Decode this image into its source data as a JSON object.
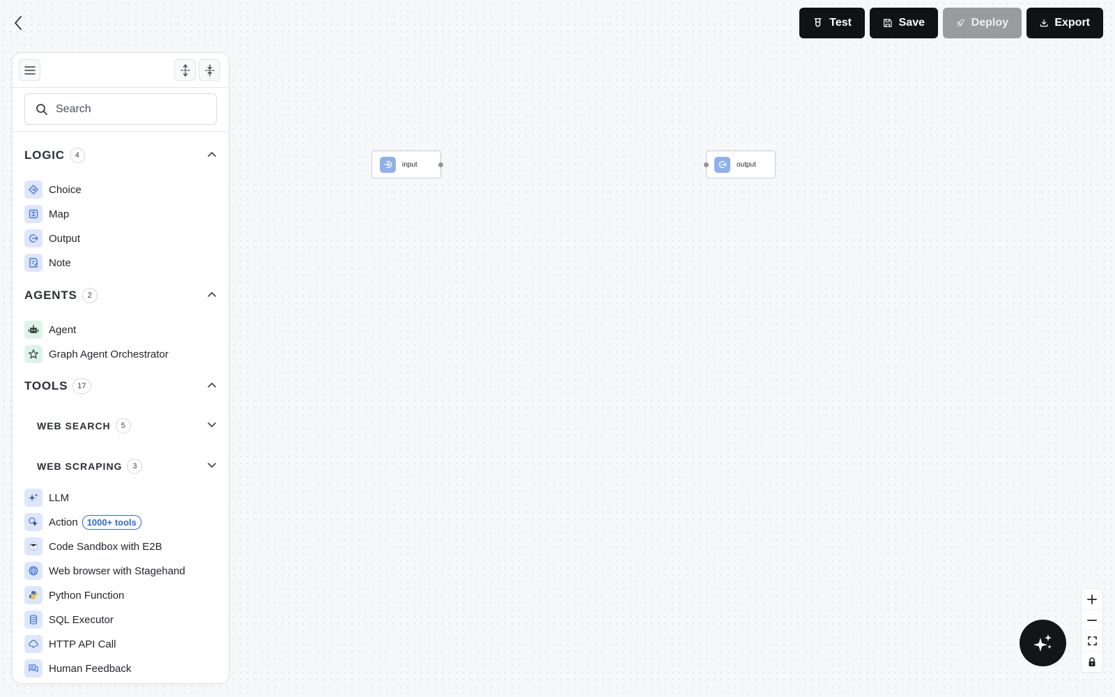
{
  "toolbar": {
    "test_label": "Test",
    "save_label": "Save",
    "deploy_label": "Deploy",
    "export_label": "Export"
  },
  "search": {
    "placeholder": "Search"
  },
  "sections": {
    "logic": {
      "title": "LOGIC",
      "count": "4",
      "items": [
        {
          "label": "Choice",
          "icon": "choice-icon"
        },
        {
          "label": "Map",
          "icon": "map-icon"
        },
        {
          "label": "Output",
          "icon": "output-icon"
        },
        {
          "label": "Note",
          "icon": "note-icon"
        }
      ]
    },
    "agents": {
      "title": "AGENTS",
      "count": "2",
      "items": [
        {
          "label": "Agent",
          "icon": "robot-icon"
        },
        {
          "label": "Graph Agent Orchestrator",
          "icon": "star-icon"
        }
      ]
    },
    "tools": {
      "title": "TOOLS",
      "count": "17",
      "groups": [
        {
          "title": "WEB SEARCH",
          "count": "5"
        },
        {
          "title": "WEB SCRAPING",
          "count": "3"
        }
      ],
      "items": [
        {
          "label": "LLM",
          "icon": "sparkle-icon"
        },
        {
          "label": "Action",
          "icon": "cursor-icon",
          "badge": "1000+ tools"
        },
        {
          "label": "Code Sandbox with E2B",
          "icon": "cube-icon"
        },
        {
          "label": "Web browser with Stagehand",
          "icon": "globe-icon"
        },
        {
          "label": "Python Function",
          "icon": "python-icon"
        },
        {
          "label": "SQL Executor",
          "icon": "database-icon"
        },
        {
          "label": "HTTP API Call",
          "icon": "cloud-icon"
        },
        {
          "label": "Human Feedback",
          "icon": "chat-icon"
        }
      ]
    }
  },
  "canvas": {
    "nodes": [
      {
        "label": "input",
        "icon": "input-icon"
      },
      {
        "label": "output",
        "icon": "output-icon"
      }
    ]
  },
  "colors": {
    "accent": "#2f6ad8",
    "button_dark": "#111214",
    "button_disabled": "#9a9b9d",
    "node_icon": "#8fb0ea"
  }
}
